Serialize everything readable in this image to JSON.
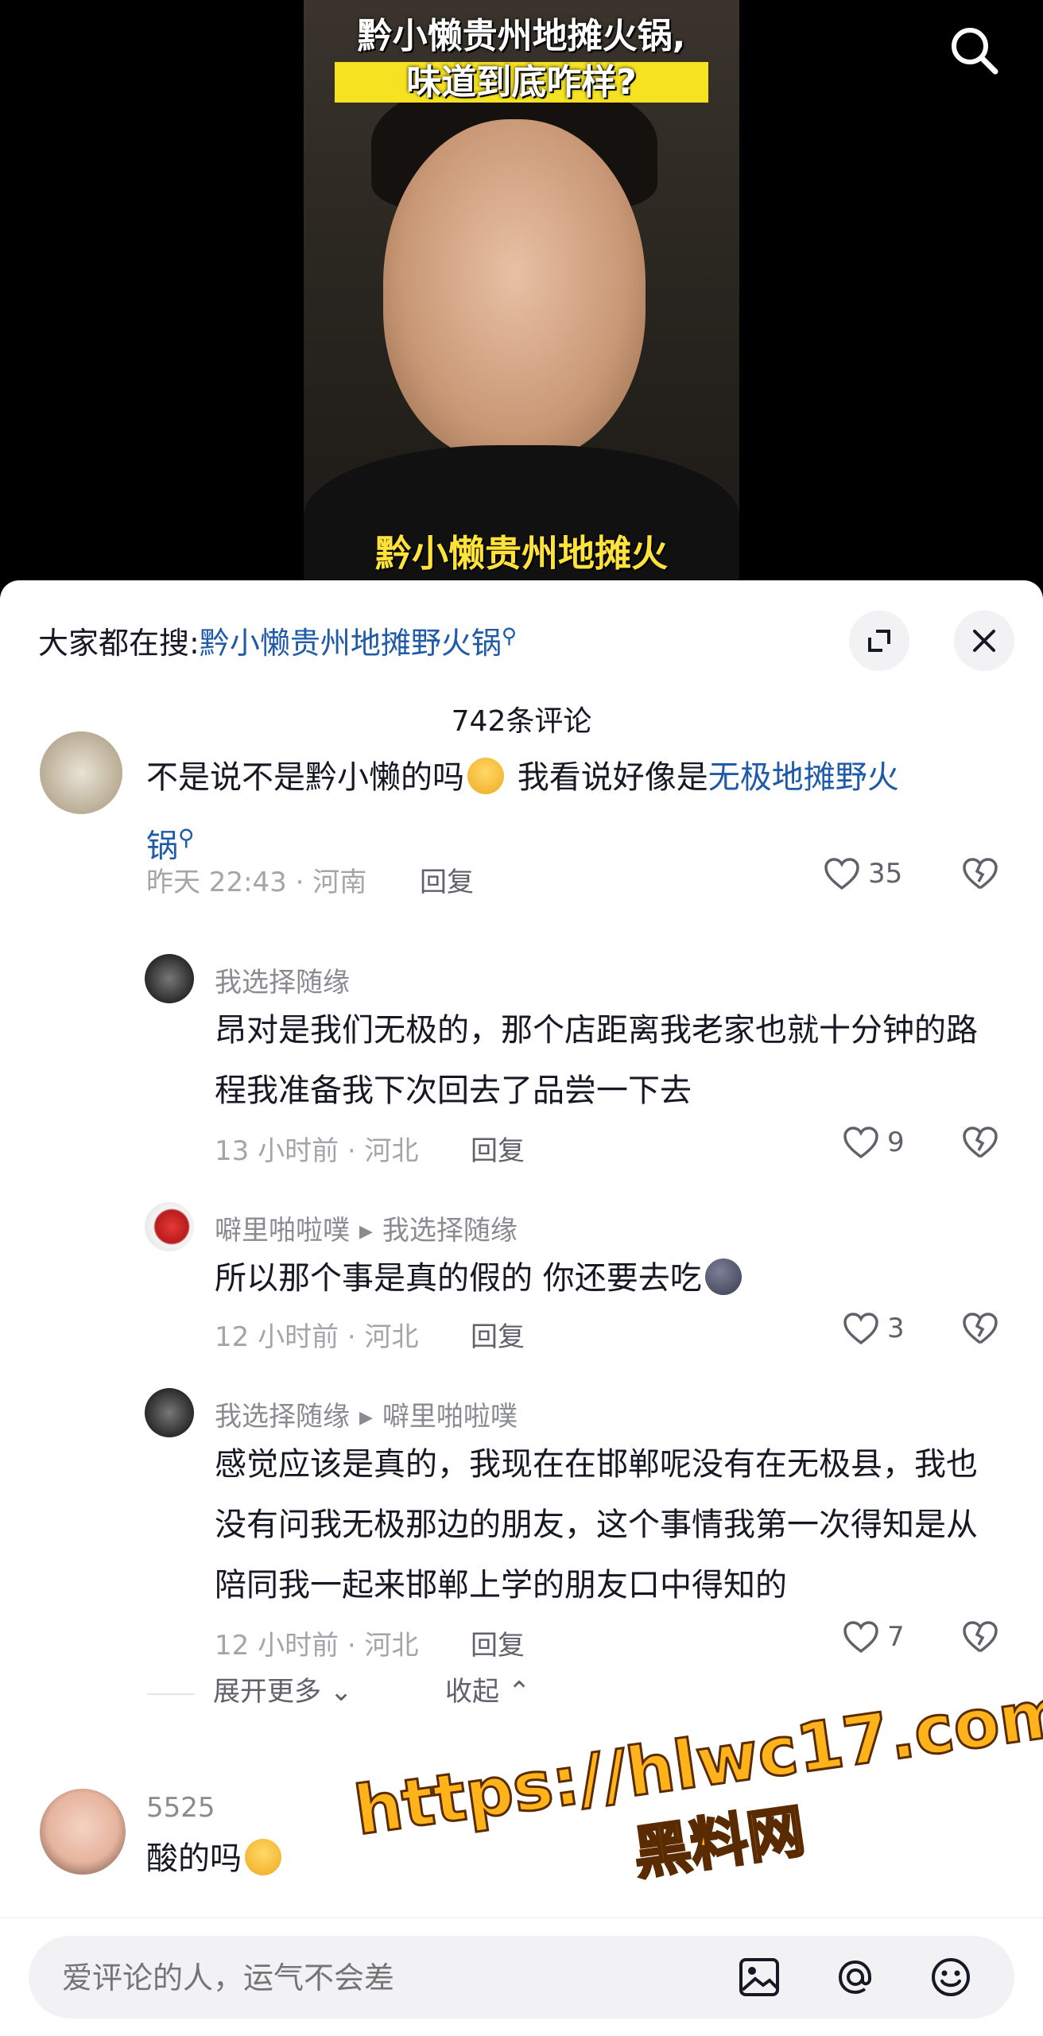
{
  "video": {
    "caption_top_line1": "黔小懒贵州地摊火锅,",
    "caption_top_line2": "味道到底咋样?",
    "caption_bottom": "黔小懒贵州地摊火"
  },
  "sheet": {
    "hot_search_prefix": "大家都在搜:",
    "hot_search_keyword": "黔小懒贵州地摊野火锅",
    "comment_count": "742条评论"
  },
  "comments": [
    {
      "text_a": "不是说不是黔小懒的吗",
      "text_b": " 我看说好像是",
      "text_kw": "无极地摊野火",
      "text_kw2": "锅",
      "meta": "昨天 22:43 · 河南",
      "reply": "回复",
      "likes": "35"
    },
    {
      "user": "我选择随缘",
      "text": "昂对是我们无极的，那个店距离我老家也就十分钟的路程我准备我下次回去了品尝一下去",
      "meta": "13 小时前 · 河北",
      "reply": "回复",
      "likes": "9"
    },
    {
      "user": "噼里啪啦噗",
      "reply_to": "我选择随缘",
      "text": "所以那个事是真的假的 你还要去吃",
      "meta": "12 小时前 · 河北",
      "reply": "回复",
      "likes": "3"
    },
    {
      "user": "我选择随缘",
      "reply_to": "噼里啪啦噗",
      "text": "感觉应该是真的，我现在在邯郸呢没有在无极县，我也没有问我无极那边的朋友，这个事情我第一次得知是从陪同我一起来邯郸上学的朋友口中得知的",
      "meta": "12 小时前 · 河北",
      "reply": "回复",
      "likes": "7"
    },
    {
      "user": "5525",
      "text": "酸的吗"
    }
  ],
  "thread": {
    "expand_more": "展开更多",
    "collapse": "收起"
  },
  "input": {
    "placeholder": "爱评论的人，运气不会差"
  },
  "watermark": {
    "url": "https://hlwc17.com",
    "name": "黑料网"
  },
  "icons": {
    "search": "search-icon",
    "fullscreen": "expand-icon",
    "close": "close-icon",
    "like": "heart-icon",
    "dislike": "broken-heart-icon",
    "image": "image-icon",
    "mention": "at-icon",
    "emoji": "emoji-icon"
  },
  "colors": {
    "link": "#1f5ba8",
    "muted": "#a4a5aa",
    "caption_yellow": "#f6e221"
  }
}
